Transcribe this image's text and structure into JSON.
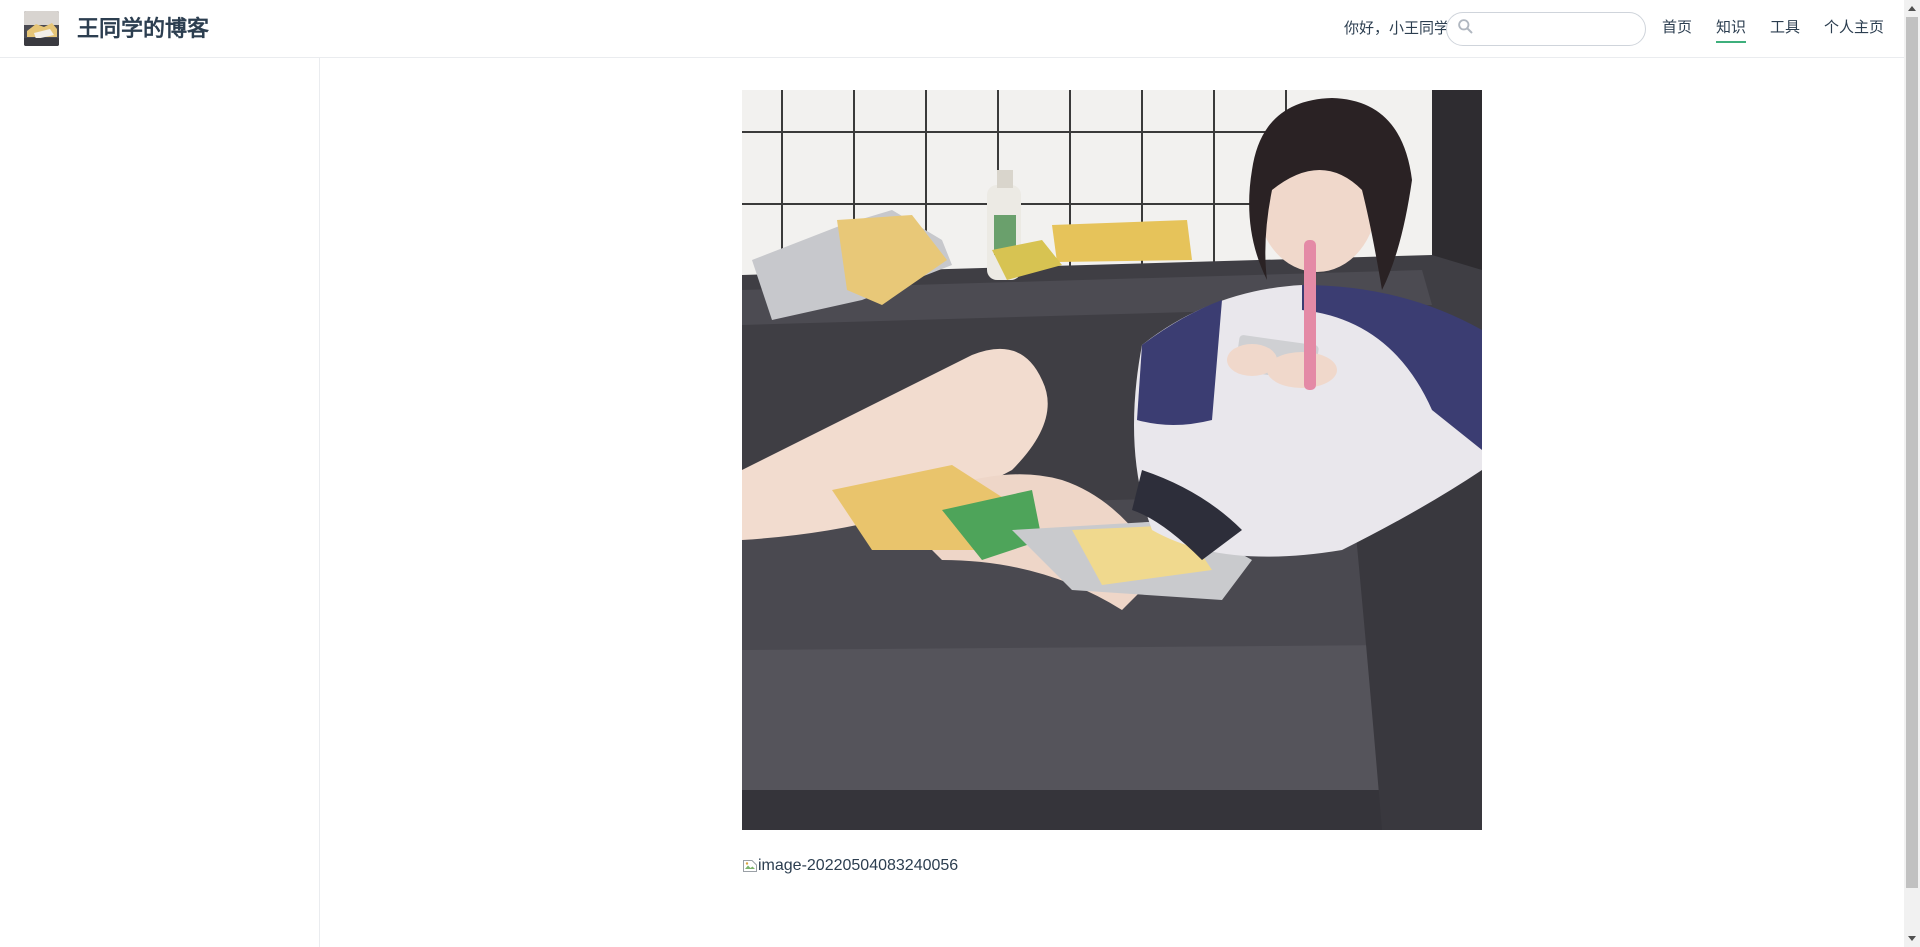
{
  "header": {
    "site_name": "王同学的博客",
    "greeting": "你好，小王同学",
    "search": {
      "value": "",
      "placeholder": ""
    },
    "nav": [
      {
        "label": "首页",
        "active": false
      },
      {
        "label": "知识",
        "active": true
      },
      {
        "label": "工具",
        "active": false
      },
      {
        "label": "个人主页",
        "active": false
      }
    ]
  },
  "content": {
    "broken_image_alt": "image-20220504083240056"
  },
  "colors": {
    "accent": "#3eaf7c",
    "text": "#2c3e50",
    "border": "#eaecef"
  },
  "scrollbar": {
    "visible_fraction": 0.92
  }
}
